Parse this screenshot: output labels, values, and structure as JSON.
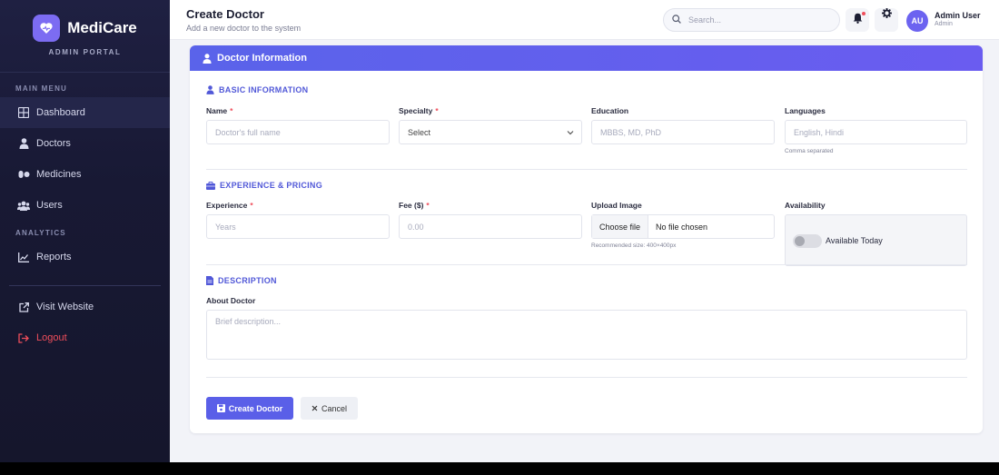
{
  "brand": {
    "name": "MediCare",
    "subtitle": "ADMIN PORTAL"
  },
  "sidebar": {
    "main_menu_label": "MAIN MENU",
    "analytics_label": "ANALYTICS",
    "items": [
      {
        "label": "Dashboard",
        "icon": "grid-icon"
      },
      {
        "label": "Doctors",
        "icon": "user-doctor-icon"
      },
      {
        "label": "Medicines",
        "icon": "pills-icon"
      },
      {
        "label": "Users",
        "icon": "users-icon"
      },
      {
        "label": "Reports",
        "icon": "chart-line-icon"
      },
      {
        "label": "Visit Website",
        "icon": "external-link-icon"
      },
      {
        "label": "Logout",
        "icon": "logout-icon"
      }
    ]
  },
  "header": {
    "title": "Create Doctor",
    "subtitle": "Add a new doctor to the system",
    "search_placeholder": "Search...",
    "user_initials": "AU",
    "user_name": "Admin User",
    "user_role": "Admin"
  },
  "card": {
    "title": "Doctor Information",
    "sections": {
      "basic": "BASIC INFORMATION",
      "experience": "EXPERIENCE & PRICING",
      "description": "DESCRIPTION"
    },
    "fields": {
      "name": {
        "label": "Name",
        "required": "*",
        "placeholder": "Doctor's full name"
      },
      "specialty": {
        "label": "Specialty",
        "required": "*",
        "value": "Select"
      },
      "education": {
        "label": "Education",
        "placeholder": "MBBS, MD, PhD"
      },
      "languages": {
        "label": "Languages",
        "placeholder": "English, Hindi",
        "hint": "Comma separated"
      },
      "experience": {
        "label": "Experience",
        "required": "*",
        "placeholder": "Years"
      },
      "fee": {
        "label": "Fee ($)",
        "required": "*",
        "placeholder": "0.00"
      },
      "upload": {
        "label": "Upload Image",
        "button": "Choose file",
        "file_status": "No file chosen",
        "hint": "Recommended size: 400×400px"
      },
      "availability": {
        "label": "Availability",
        "toggle_label": "Available Today",
        "toggle_on": false
      },
      "about": {
        "label": "About Doctor",
        "placeholder": "Brief description..."
      }
    },
    "buttons": {
      "create": "Create Doctor",
      "cancel": "Cancel"
    }
  },
  "colors": {
    "accent": "#5a5fe8",
    "sidebar_bg": "#1b1c38",
    "danger": "#ef4e5b"
  }
}
